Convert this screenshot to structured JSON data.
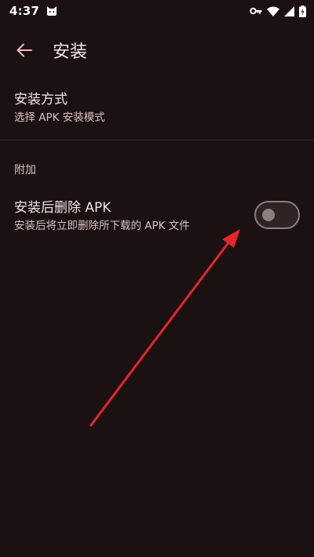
{
  "status_bar": {
    "time": "4:37",
    "icons": [
      "cat-icon",
      "vpn-key-icon",
      "wifi-icon",
      "cellular-icon",
      "battery-icon"
    ]
  },
  "app_bar": {
    "back_icon": "arrow-back-icon",
    "title": "安装"
  },
  "preferences": {
    "install_method": {
      "title": "安装方式",
      "summary": "选择 APK 安装模式"
    },
    "category": "附加",
    "delete_apk": {
      "title": "安装后删除 APK",
      "summary": "安装后将立即删除所下载的 APK 文件",
      "enabled": false
    }
  },
  "colors": {
    "background": "#1b1112",
    "text_primary": "#f3e4e4",
    "text_secondary": "#d6c2c2",
    "accent_back": "#f0b8bd",
    "toggle_off": "#8f7f80",
    "annotation_arrow": "#e3262e"
  }
}
